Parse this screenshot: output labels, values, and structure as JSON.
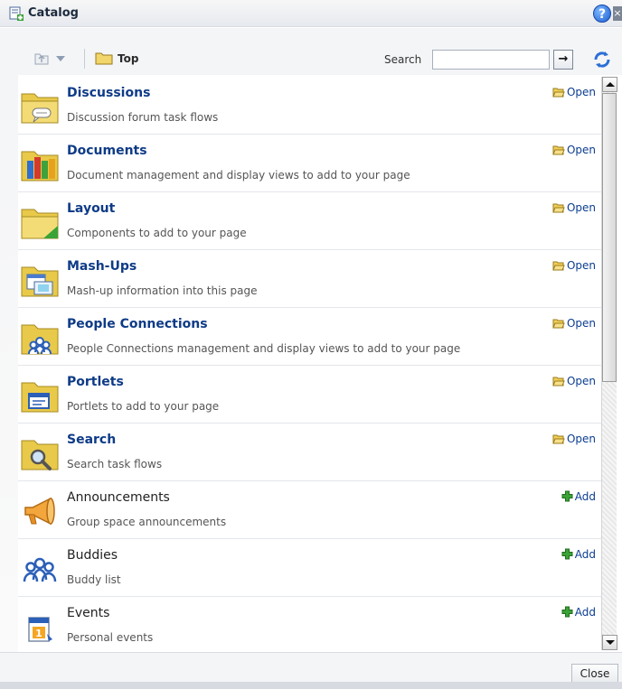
{
  "window": {
    "title": "Catalog",
    "help_glyph": "?",
    "close_glyph": "×"
  },
  "toolbar": {
    "breadcrumb": "Top",
    "search_label": "Search",
    "search_value": "",
    "search_go_glyph": "→"
  },
  "items": [
    {
      "title": "Discussions",
      "description": "Discussion forum task flows",
      "action": "Open",
      "kind": "folder",
      "icon": "discussions-folder-icon"
    },
    {
      "title": "Documents",
      "description": "Document management and display views to add to your page",
      "action": "Open",
      "kind": "folder",
      "icon": "documents-folder-icon"
    },
    {
      "title": "Layout",
      "description": "Components to add to your page",
      "action": "Open",
      "kind": "folder",
      "icon": "layout-folder-icon"
    },
    {
      "title": "Mash-Ups",
      "description": "Mash-up information into this page",
      "action": "Open",
      "kind": "folder",
      "icon": "mashups-folder-icon"
    },
    {
      "title": "People Connections",
      "description": "People Connections management and display views to add to your page",
      "action": "Open",
      "kind": "folder",
      "icon": "people-connections-folder-icon"
    },
    {
      "title": "Portlets",
      "description": "Portlets to add to your page",
      "action": "Open",
      "kind": "folder",
      "icon": "portlets-folder-icon"
    },
    {
      "title": "Search",
      "description": "Search task flows",
      "action": "Open",
      "kind": "folder",
      "icon": "search-folder-icon"
    },
    {
      "title": "Announcements",
      "description": "Group space announcements",
      "action": "Add",
      "kind": "component",
      "icon": "megaphone-icon"
    },
    {
      "title": "Buddies",
      "description": "Buddy list",
      "action": "Add",
      "kind": "component",
      "icon": "people-icon"
    },
    {
      "title": "Events",
      "description": "Personal events",
      "action": "Add",
      "kind": "component",
      "icon": "calendar-icon"
    }
  ],
  "footer": {
    "close_label": "Close"
  },
  "colors": {
    "link": "#0e3b87",
    "add_green": "#3aa335",
    "folder_yellow": "#e8c94a"
  }
}
